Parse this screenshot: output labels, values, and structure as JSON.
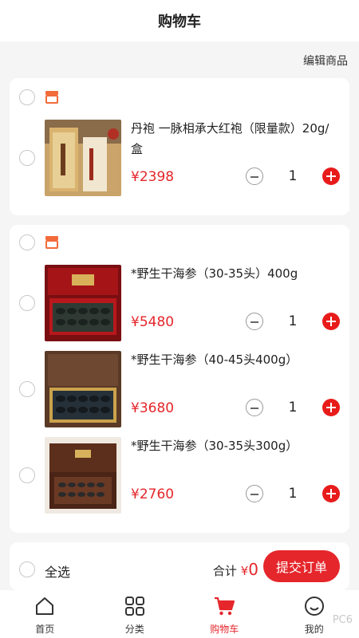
{
  "header": {
    "title": "购物车"
  },
  "edit_label": "编辑商品",
  "stores": [
    {
      "items": [
        {
          "name": "丹袍 一脉相承大红袍（限量款）20g/盒",
          "price": "¥2398",
          "qty": "1"
        }
      ]
    },
    {
      "items": [
        {
          "name": "*野生干海参（30-35头）400g",
          "price": "¥5480",
          "qty": "1"
        },
        {
          "name": "*野生干海参（40-45头400g）",
          "price": "¥3680",
          "qty": "1"
        },
        {
          "name": "*野生干海参（30-35头300g）",
          "price": "¥2760",
          "qty": "1"
        }
      ]
    }
  ],
  "footer": {
    "select_all": "全选",
    "total_label": "合计",
    "currency": "¥",
    "total_amount": "0",
    "submit_label": "提交订单"
  },
  "tabs": [
    {
      "label": "首页",
      "icon": "home-icon"
    },
    {
      "label": "分类",
      "icon": "category-icon"
    },
    {
      "label": "购物车",
      "icon": "cart-icon",
      "active": true
    },
    {
      "label": "我的",
      "icon": "profile-icon"
    }
  ],
  "watermark": "PC6",
  "colors": {
    "accent": "#e5262b",
    "store_icon": "#f26b3a"
  }
}
